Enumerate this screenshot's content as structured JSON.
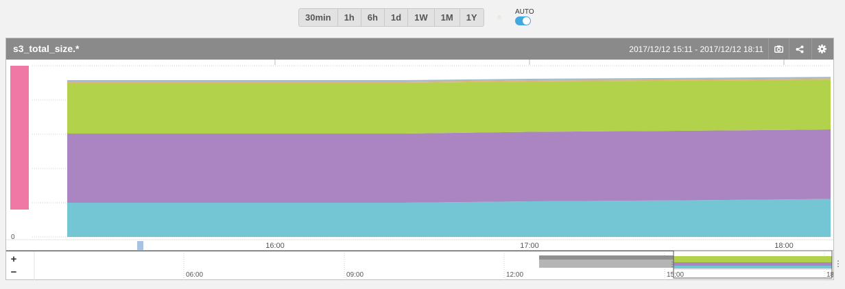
{
  "toolbar": {
    "ranges": [
      "30min",
      "1h",
      "6h",
      "1d",
      "1W",
      "1M",
      "1Y"
    ],
    "auto_label": "AUTO",
    "auto_enabled": true
  },
  "panel": {
    "title": "s3_total_size.*",
    "time_range": "2017/12/12 15:11 - 2017/12/12 18:11",
    "buttons": [
      "camera-icon",
      "share-icon",
      "gear-icon"
    ]
  },
  "navigator": {
    "zoom_in": "+",
    "zoom_out": "−",
    "ticks": [
      "06:00",
      "09:00",
      "12:00",
      "15:00",
      "18:"
    ],
    "more_label": "⋮"
  },
  "chart_data": {
    "type": "area",
    "stacked": true,
    "x": [
      "15:11",
      "16:00",
      "16:30",
      "17:00",
      "17:30",
      "18:00",
      "18:11"
    ],
    "xticks": [
      "16:00",
      "17:00",
      "18:00"
    ],
    "yticks": [
      "0"
    ],
    "ylim": [
      0,
      100
    ],
    "series": [
      {
        "color": "#74c6d4",
        "values": [
          20.0,
          20.0,
          20.0,
          20.8,
          21.3,
          21.9,
          22.2
        ]
      },
      {
        "color": "#aa85c1",
        "values": [
          40.4,
          40.4,
          40.4,
          40.6,
          40.6,
          40.6,
          40.6
        ]
      },
      {
        "color": "#b3d24c",
        "values": [
          29.6,
          29.6,
          29.6,
          29.4,
          29.3,
          29.2,
          29.1
        ]
      },
      {
        "color": "#e2b080",
        "values": [
          0.8,
          0.8,
          0.8,
          0.8,
          0.8,
          0.8,
          0.8
        ]
      },
      {
        "color": "#9cbcd0",
        "values": [
          0.8,
          0.8,
          0.8,
          0.8,
          0.8,
          0.8,
          0.8
        ]
      }
    ],
    "grid": true,
    "legend": "none",
    "side_marker_color": "#ef78a4",
    "scroll_marker_color": "#a9c1e2"
  }
}
